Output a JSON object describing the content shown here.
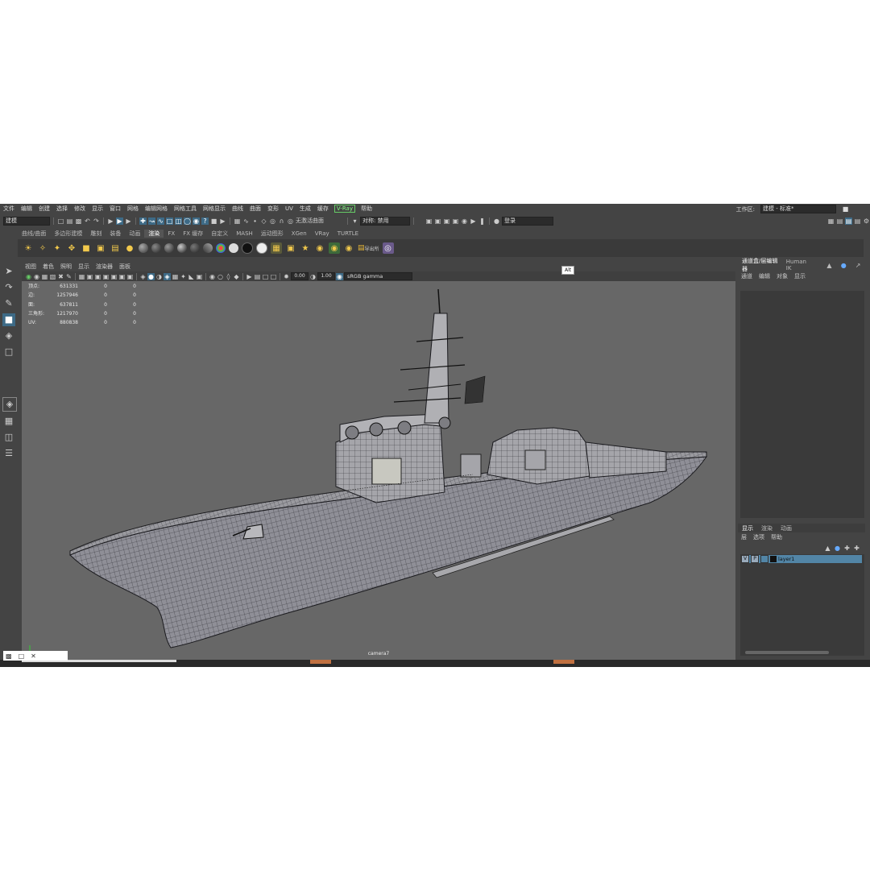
{
  "menubar": {
    "items": [
      "文件",
      "编辑",
      "创建",
      "选择",
      "修改",
      "显示",
      "窗口",
      "网格",
      "编辑网格",
      "网格工具",
      "网格显示",
      "曲线",
      "曲面",
      "变形",
      "UV",
      "生成",
      "缓存",
      "V-Ray",
      "帮助"
    ],
    "workspace_label": "工作区:",
    "workspace_value": "建模 - 标准*"
  },
  "statusline": {
    "mode": "建模",
    "live_surface": "无激活曲面",
    "symmetry": "对称: 禁用",
    "login": "登录"
  },
  "shelf": {
    "tabs": [
      "曲线/曲面",
      "多边形建模",
      "雕刻",
      "装备",
      "动画",
      "渲染",
      "FX",
      "FX 缓存",
      "自定义",
      "MASH",
      "运动图形",
      "XGen",
      "VRay",
      "TURTLE"
    ],
    "active_tab": "渲染",
    "export_label": "导出所"
  },
  "viewport": {
    "menu": [
      "视图",
      "着色",
      "照明",
      "显示",
      "渲染器",
      "面板"
    ],
    "exposure": "0.00",
    "gamma_value": "1.00",
    "color_space": "sRGB gamma",
    "camera_name": "camera7",
    "tooltip": "Alt"
  },
  "hud": {
    "rows": [
      {
        "label": "顶点:",
        "value": "631331",
        "a": "0",
        "b": "0"
      },
      {
        "label": "边:",
        "value": "1257946",
        "a": "0",
        "b": "0"
      },
      {
        "label": "面:",
        "value": "637811",
        "a": "0",
        "b": "0"
      },
      {
        "label": "三角形:",
        "value": "1217970",
        "a": "0",
        "b": "0"
      },
      {
        "label": "UV:",
        "value": "880838",
        "a": "0",
        "b": "0"
      }
    ]
  },
  "channel_box": {
    "tabs": [
      "通道盒/层编辑器",
      "Human IK"
    ],
    "menu": [
      "通道",
      "编辑",
      "对象",
      "显示"
    ]
  },
  "layer_editor": {
    "tabs": [
      "显示",
      "渲染",
      "动画"
    ],
    "menu": [
      "层",
      "选项",
      "帮助"
    ],
    "layer": {
      "v": "V",
      "p": "P",
      "name": "layer1"
    }
  },
  "colors": {
    "ui_bg": "#444444",
    "viewport_bg": "#676767",
    "accent": "#3d6a86",
    "layer_highlight": "#5285a6"
  }
}
